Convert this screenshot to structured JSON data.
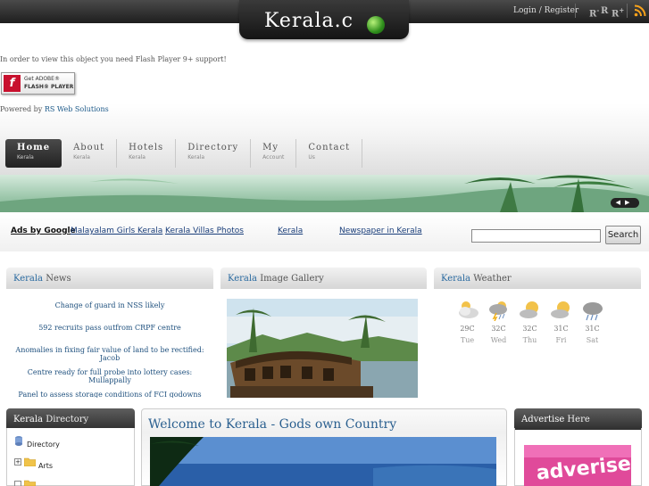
{
  "header": {
    "logo_text": "Kerala.c",
    "login_link": "Login / Register",
    "font_sizes": [
      "R",
      "R",
      "R"
    ],
    "font_size_marks": [
      "-",
      "",
      "+"
    ],
    "rss_icon": "rss-icon"
  },
  "flash": {
    "message": "In order to view this object you need Flash Player 9+ support!",
    "button_line1": "Get ADOBE®",
    "button_line2": "FLASH® PLAYER",
    "button_logo": "f"
  },
  "powered": {
    "prefix": "Powered by ",
    "link": "RS Web Solutions"
  },
  "nav": {
    "items": [
      {
        "label": "Home",
        "sub": "Kerala"
      },
      {
        "label": "About",
        "sub": "Kerala"
      },
      {
        "label": "Hotels",
        "sub": "Kerala"
      },
      {
        "label": "Directory",
        "sub": "Kerala"
      },
      {
        "label": "My",
        "sub": "Account"
      },
      {
        "label": "Contact",
        "sub": "Us"
      }
    ]
  },
  "slider": {
    "prev": "◀",
    "next": "▶"
  },
  "ads": {
    "label": "Ads by Google",
    "links": [
      "Malayalam Girls Kerala",
      "Kerala Villas Photos",
      "Kerala",
      "Newspaper in Kerala"
    ]
  },
  "search": {
    "button": "Search",
    "value": ""
  },
  "panels": {
    "news": {
      "accent": "Kerala",
      "title": " News"
    },
    "gallery": {
      "accent": "Kerala",
      "title": " Image Gallery"
    },
    "weather": {
      "accent": "Kerala",
      "title": " Weather"
    },
    "directory": {
      "accent": "Kerala",
      "title": " Directory"
    },
    "advertise": {
      "accent": "Advertise",
      "title": " Here"
    }
  },
  "news": [
    "Change of guard in NSS likely",
    "592 recruits pass outfrom CRPF centre",
    "Anomalies in fixing fair value of land to be rectified: Jacob",
    "Centre ready for full probe into lottery cases: Mullappally",
    "Panel to assess storage conditions of FCI godowns"
  ],
  "weather": [
    {
      "temp": "29C",
      "day": "Tue",
      "icon": "cloudy-sun-icon"
    },
    {
      "temp": "32C",
      "day": "Wed",
      "icon": "storm-icon"
    },
    {
      "temp": "32C",
      "day": "Thu",
      "icon": "partly-cloudy-icon"
    },
    {
      "temp": "31C",
      "day": "Fri",
      "icon": "partly-cloudy-icon"
    },
    {
      "temp": "31C",
      "day": "Sat",
      "icon": "storm-icon"
    }
  ],
  "directory": {
    "root": "Directory",
    "items": [
      "Arts"
    ]
  },
  "welcome": {
    "title": "Welcome to Kerala - Gods own Country"
  },
  "advert": {
    "text": "adverise"
  },
  "colors": {
    "accent": "#2a6aa0",
    "link": "#1a3e7a",
    "nav_dark": "#2a2a2a"
  }
}
